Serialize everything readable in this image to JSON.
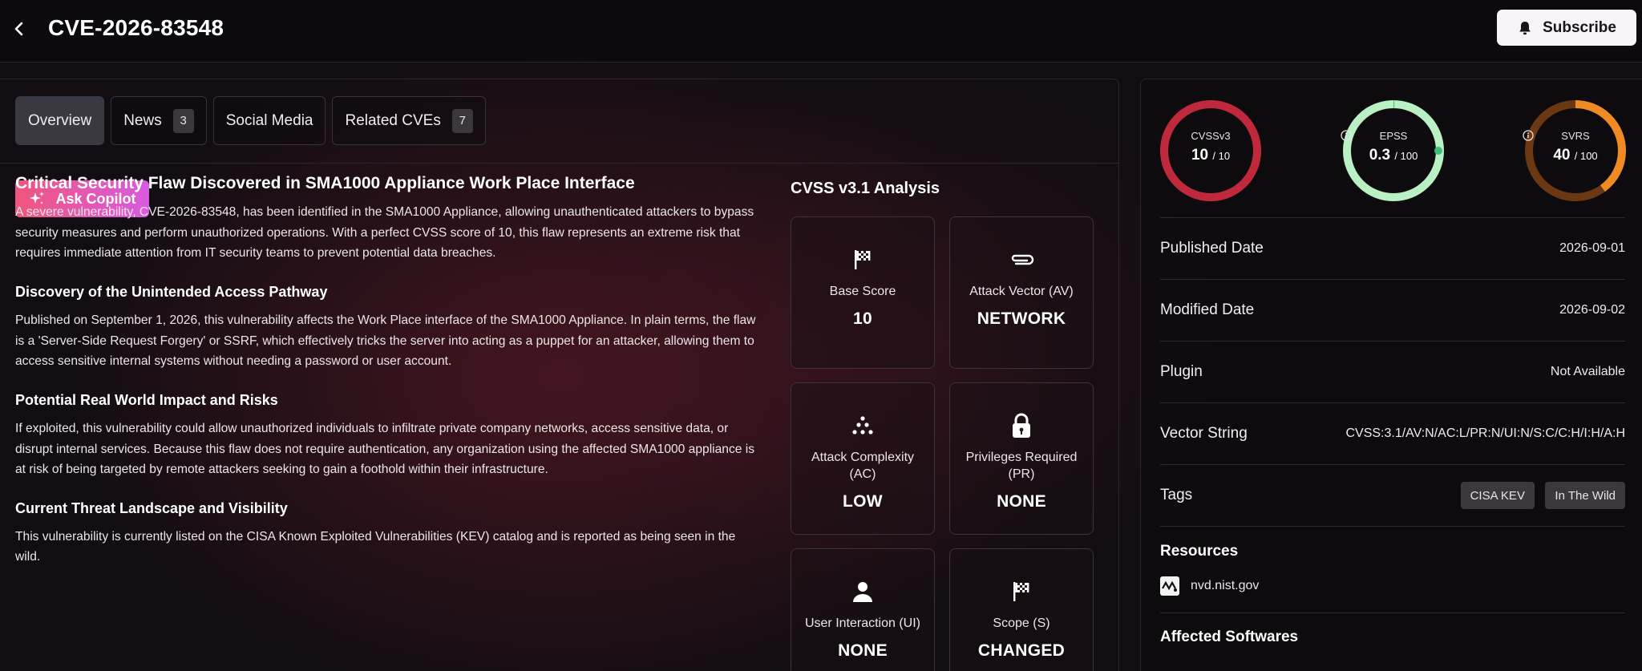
{
  "header": {
    "title": "CVE-2026-83548",
    "subscribe_label": "Subscribe"
  },
  "tabs": [
    {
      "label": "Overview",
      "count": null,
      "active": true
    },
    {
      "label": "News",
      "count": "3"
    },
    {
      "label": "Social Media",
      "count": null
    },
    {
      "label": "Related CVEs",
      "count": "7"
    }
  ],
  "copilot_label": "Ask Copilot",
  "article": {
    "title": "Critical Security Flaw Discovered in SMA1000 Appliance Work Place Interface",
    "intro": "A severe vulnerability, CVE-2026-83548, has been identified in the SMA1000 Appliance, allowing unauthenticated attackers to bypass security measures and perform unauthorized operations. With a perfect CVSS score of 10, this flaw represents an extreme risk that requires immediate attention from IT security teams to prevent potential data breaches.",
    "sections": [
      {
        "heading": "Discovery of the Unintended Access Pathway",
        "body": "Published on September 1, 2026, this vulnerability affects the Work Place interface of the SMA1000 Appliance. In plain terms, the flaw is a 'Server-Side Request Forgery' or SSRF, which effectively tricks the server into acting as a puppet for an attacker, allowing them to access sensitive internal systems without needing a password or user account."
      },
      {
        "heading": "Potential Real World Impact and Risks",
        "body": "If exploited, this vulnerability could allow unauthorized individuals to infiltrate private company networks, access sensitive data, or disrupt internal services. Because this flaw does not require authentication, any organization using the affected SMA1000 appliance is at risk of being targeted by remote attackers seeking to gain a foothold within their infrastructure."
      },
      {
        "heading": "Current Threat Landscape and Visibility",
        "body": "This vulnerability is currently listed on the CISA Known Exploited Vulnerabilities (KEV) catalog and is reported as being seen in the wild."
      }
    ]
  },
  "cvss": {
    "title": "CVSS v3.1 Analysis",
    "metrics": [
      {
        "label": "Base Score",
        "value": "10",
        "icon": "flag-icon"
      },
      {
        "label": "Attack Vector (AV)",
        "value": "NETWORK",
        "icon": "paperclip-icon"
      },
      {
        "label": "Attack Complexity (AC)",
        "value": "LOW",
        "icon": "dots-icon"
      },
      {
        "label": "Privileges Required (PR)",
        "value": "NONE",
        "icon": "lock-icon"
      },
      {
        "label": "User Interaction (UI)",
        "value": "NONE",
        "icon": "user-icon"
      },
      {
        "label": "Scope (S)",
        "value": "CHANGED",
        "icon": "flag-icon"
      }
    ]
  },
  "scores": [
    {
      "label": "CVSSv3",
      "value": "10",
      "max": "/ 10",
      "fraction": 1.0,
      "color": "#c0283c",
      "info": false
    },
    {
      "label": "EPSS",
      "value": "0.3",
      "max": "/ 100",
      "fraction": 0.003,
      "color": "#b9f0c4",
      "accent": "#3dbf7a",
      "info": true
    },
    {
      "label": "SVRS",
      "value": "40",
      "max": "/ 100",
      "fraction": 0.4,
      "color": "#f08a24",
      "track": "#6b3813",
      "info": true
    }
  ],
  "details": {
    "published_label": "Published Date",
    "published_value": "2026-09-01",
    "modified_label": "Modified Date",
    "modified_value": "2026-09-02",
    "plugin_label": "Plugin",
    "plugin_value": "Not Available",
    "vector_label": "Vector String",
    "vector_value": "CVSS:3.1/AV:N/AC:L/PR:N/UI:N/S:C/C:H/I:H/A:H",
    "tags_label": "Tags",
    "tags": [
      "CISA KEV",
      "In The Wild"
    ],
    "resources_label": "Resources",
    "resource_link": "nvd.nist.gov",
    "affected_label": "Affected Softwares"
  }
}
